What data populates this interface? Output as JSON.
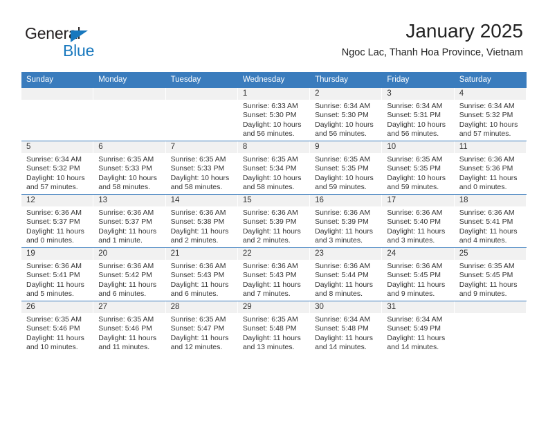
{
  "logo": {
    "word1": "General",
    "word2": "Blue",
    "triangle_color": "#1878be",
    "word1_color": "#231f20",
    "word2_color": "#1878be"
  },
  "header": {
    "title": "January 2025",
    "subtitle": "Ngoc Lac, Thanh Hoa Province, Vietnam"
  },
  "theme": {
    "header_blue": "#3a7cbd",
    "daynum_band": "#f1f1f1",
    "text": "#333333"
  },
  "calendar": {
    "weekday_headers": [
      "Sunday",
      "Monday",
      "Tuesday",
      "Wednesday",
      "Thursday",
      "Friday",
      "Saturday"
    ],
    "weeks": [
      [
        {
          "day": "",
          "sunrise": "",
          "sunset": "",
          "daylight1": "",
          "daylight2": ""
        },
        {
          "day": "",
          "sunrise": "",
          "sunset": "",
          "daylight1": "",
          "daylight2": ""
        },
        {
          "day": "",
          "sunrise": "",
          "sunset": "",
          "daylight1": "",
          "daylight2": ""
        },
        {
          "day": "1",
          "sunrise": "Sunrise: 6:33 AM",
          "sunset": "Sunset: 5:30 PM",
          "daylight1": "Daylight: 10 hours",
          "daylight2": "and 56 minutes."
        },
        {
          "day": "2",
          "sunrise": "Sunrise: 6:34 AM",
          "sunset": "Sunset: 5:30 PM",
          "daylight1": "Daylight: 10 hours",
          "daylight2": "and 56 minutes."
        },
        {
          "day": "3",
          "sunrise": "Sunrise: 6:34 AM",
          "sunset": "Sunset: 5:31 PM",
          "daylight1": "Daylight: 10 hours",
          "daylight2": "and 56 minutes."
        },
        {
          "day": "4",
          "sunrise": "Sunrise: 6:34 AM",
          "sunset": "Sunset: 5:32 PM",
          "daylight1": "Daylight: 10 hours",
          "daylight2": "and 57 minutes."
        }
      ],
      [
        {
          "day": "5",
          "sunrise": "Sunrise: 6:34 AM",
          "sunset": "Sunset: 5:32 PM",
          "daylight1": "Daylight: 10 hours",
          "daylight2": "and 57 minutes."
        },
        {
          "day": "6",
          "sunrise": "Sunrise: 6:35 AM",
          "sunset": "Sunset: 5:33 PM",
          "daylight1": "Daylight: 10 hours",
          "daylight2": "and 58 minutes."
        },
        {
          "day": "7",
          "sunrise": "Sunrise: 6:35 AM",
          "sunset": "Sunset: 5:33 PM",
          "daylight1": "Daylight: 10 hours",
          "daylight2": "and 58 minutes."
        },
        {
          "day": "8",
          "sunrise": "Sunrise: 6:35 AM",
          "sunset": "Sunset: 5:34 PM",
          "daylight1": "Daylight: 10 hours",
          "daylight2": "and 58 minutes."
        },
        {
          "day": "9",
          "sunrise": "Sunrise: 6:35 AM",
          "sunset": "Sunset: 5:35 PM",
          "daylight1": "Daylight: 10 hours",
          "daylight2": "and 59 minutes."
        },
        {
          "day": "10",
          "sunrise": "Sunrise: 6:35 AM",
          "sunset": "Sunset: 5:35 PM",
          "daylight1": "Daylight: 10 hours",
          "daylight2": "and 59 minutes."
        },
        {
          "day": "11",
          "sunrise": "Sunrise: 6:36 AM",
          "sunset": "Sunset: 5:36 PM",
          "daylight1": "Daylight: 11 hours",
          "daylight2": "and 0 minutes."
        }
      ],
      [
        {
          "day": "12",
          "sunrise": "Sunrise: 6:36 AM",
          "sunset": "Sunset: 5:37 PM",
          "daylight1": "Daylight: 11 hours",
          "daylight2": "and 0 minutes."
        },
        {
          "day": "13",
          "sunrise": "Sunrise: 6:36 AM",
          "sunset": "Sunset: 5:37 PM",
          "daylight1": "Daylight: 11 hours",
          "daylight2": "and 1 minute."
        },
        {
          "day": "14",
          "sunrise": "Sunrise: 6:36 AM",
          "sunset": "Sunset: 5:38 PM",
          "daylight1": "Daylight: 11 hours",
          "daylight2": "and 2 minutes."
        },
        {
          "day": "15",
          "sunrise": "Sunrise: 6:36 AM",
          "sunset": "Sunset: 5:39 PM",
          "daylight1": "Daylight: 11 hours",
          "daylight2": "and 2 minutes."
        },
        {
          "day": "16",
          "sunrise": "Sunrise: 6:36 AM",
          "sunset": "Sunset: 5:39 PM",
          "daylight1": "Daylight: 11 hours",
          "daylight2": "and 3 minutes."
        },
        {
          "day": "17",
          "sunrise": "Sunrise: 6:36 AM",
          "sunset": "Sunset: 5:40 PM",
          "daylight1": "Daylight: 11 hours",
          "daylight2": "and 3 minutes."
        },
        {
          "day": "18",
          "sunrise": "Sunrise: 6:36 AM",
          "sunset": "Sunset: 5:41 PM",
          "daylight1": "Daylight: 11 hours",
          "daylight2": "and 4 minutes."
        }
      ],
      [
        {
          "day": "19",
          "sunrise": "Sunrise: 6:36 AM",
          "sunset": "Sunset: 5:41 PM",
          "daylight1": "Daylight: 11 hours",
          "daylight2": "and 5 minutes."
        },
        {
          "day": "20",
          "sunrise": "Sunrise: 6:36 AM",
          "sunset": "Sunset: 5:42 PM",
          "daylight1": "Daylight: 11 hours",
          "daylight2": "and 6 minutes."
        },
        {
          "day": "21",
          "sunrise": "Sunrise: 6:36 AM",
          "sunset": "Sunset: 5:43 PM",
          "daylight1": "Daylight: 11 hours",
          "daylight2": "and 6 minutes."
        },
        {
          "day": "22",
          "sunrise": "Sunrise: 6:36 AM",
          "sunset": "Sunset: 5:43 PM",
          "daylight1": "Daylight: 11 hours",
          "daylight2": "and 7 minutes."
        },
        {
          "day": "23",
          "sunrise": "Sunrise: 6:36 AM",
          "sunset": "Sunset: 5:44 PM",
          "daylight1": "Daylight: 11 hours",
          "daylight2": "and 8 minutes."
        },
        {
          "day": "24",
          "sunrise": "Sunrise: 6:36 AM",
          "sunset": "Sunset: 5:45 PM",
          "daylight1": "Daylight: 11 hours",
          "daylight2": "and 9 minutes."
        },
        {
          "day": "25",
          "sunrise": "Sunrise: 6:35 AM",
          "sunset": "Sunset: 5:45 PM",
          "daylight1": "Daylight: 11 hours",
          "daylight2": "and 9 minutes."
        }
      ],
      [
        {
          "day": "26",
          "sunrise": "Sunrise: 6:35 AM",
          "sunset": "Sunset: 5:46 PM",
          "daylight1": "Daylight: 11 hours",
          "daylight2": "and 10 minutes."
        },
        {
          "day": "27",
          "sunrise": "Sunrise: 6:35 AM",
          "sunset": "Sunset: 5:46 PM",
          "daylight1": "Daylight: 11 hours",
          "daylight2": "and 11 minutes."
        },
        {
          "day": "28",
          "sunrise": "Sunrise: 6:35 AM",
          "sunset": "Sunset: 5:47 PM",
          "daylight1": "Daylight: 11 hours",
          "daylight2": "and 12 minutes."
        },
        {
          "day": "29",
          "sunrise": "Sunrise: 6:35 AM",
          "sunset": "Sunset: 5:48 PM",
          "daylight1": "Daylight: 11 hours",
          "daylight2": "and 13 minutes."
        },
        {
          "day": "30",
          "sunrise": "Sunrise: 6:34 AM",
          "sunset": "Sunset: 5:48 PM",
          "daylight1": "Daylight: 11 hours",
          "daylight2": "and 14 minutes."
        },
        {
          "day": "31",
          "sunrise": "Sunrise: 6:34 AM",
          "sunset": "Sunset: 5:49 PM",
          "daylight1": "Daylight: 11 hours",
          "daylight2": "and 14 minutes."
        },
        {
          "day": "",
          "sunrise": "",
          "sunset": "",
          "daylight1": "",
          "daylight2": ""
        }
      ]
    ]
  }
}
